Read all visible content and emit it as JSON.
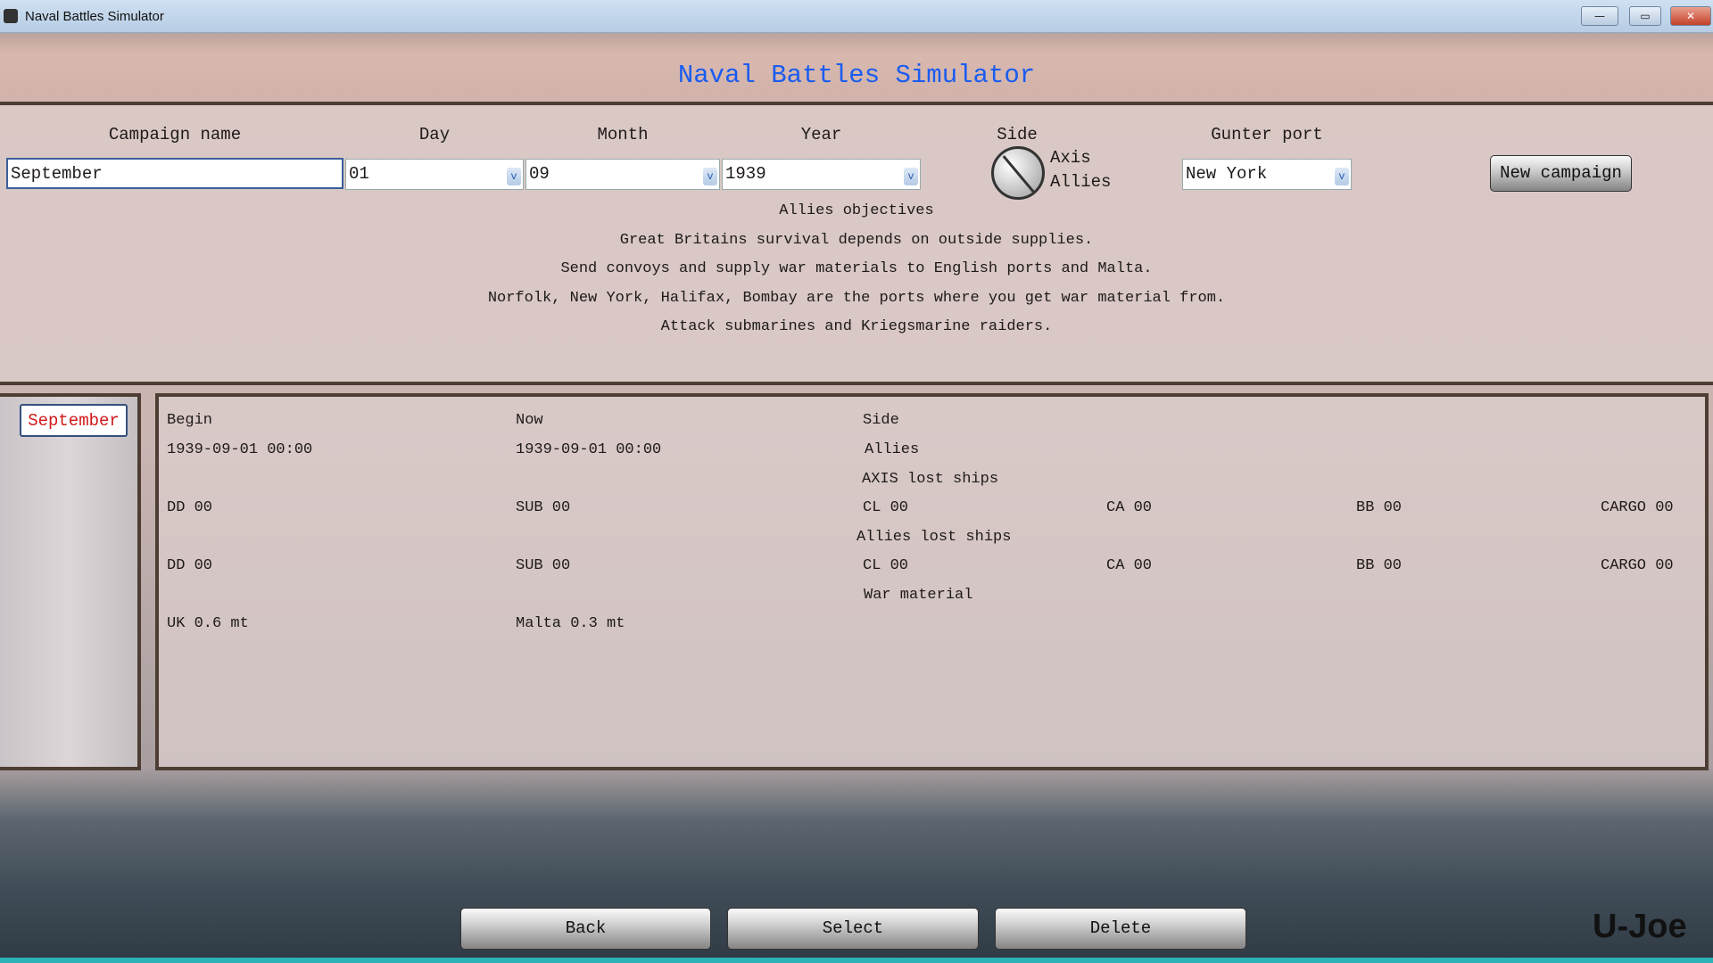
{
  "window": {
    "title": "Naval Battles Simulator",
    "minimize": "—",
    "maximize": "▭",
    "close": "✕"
  },
  "app_title": "Naval Battles Simulator",
  "form": {
    "campaign_name_label": "Campaign name",
    "campaign_name_value": "September",
    "day_label": "Day",
    "day_value": "01",
    "month_label": "Month",
    "month_value": "09",
    "year_label": "Year",
    "year_value": "1939",
    "side_label": "Side",
    "side_options": [
      "Axis",
      "Allies"
    ],
    "port_label": "Gunter port",
    "port_value": "New York",
    "new_campaign": "New campaign"
  },
  "objectives": {
    "title": "Allies objectives",
    "lines": [
      "Great Britains survival depends on outside supplies.",
      "Send convoys and supply war materials to English ports and Malta.",
      "Norfolk, New York, Halifax, Bombay are the ports where you get war material from.",
      "Attack  submarines and Kriegsmarine raiders."
    ]
  },
  "campaigns": [
    "September"
  ],
  "details": {
    "begin_label": "Begin",
    "now_label": "Now",
    "side_label": "Side",
    "begin": "1939-09-01  00:00",
    "now": "1939-09-01  00:00",
    "side": "Allies",
    "axis_lost_title": "AXIS lost ships",
    "axis_lost": [
      "DD 00",
      "SUB 00",
      "CL 00",
      "CA 00",
      "BB 00",
      "CARGO 00"
    ],
    "allies_lost_title": "Allies lost ships",
    "allies_lost": [
      "DD 00",
      "SUB 00",
      "CL 00",
      "CA 00",
      "BB 00",
      "CARGO 00"
    ],
    "war_material_title": "War material",
    "war_material": [
      "UK 0.6 mt",
      "Malta 0.3 mt"
    ]
  },
  "buttons": {
    "back": "Back",
    "select": "Select",
    "delete": "Delete"
  },
  "watermark": "U-Joe"
}
